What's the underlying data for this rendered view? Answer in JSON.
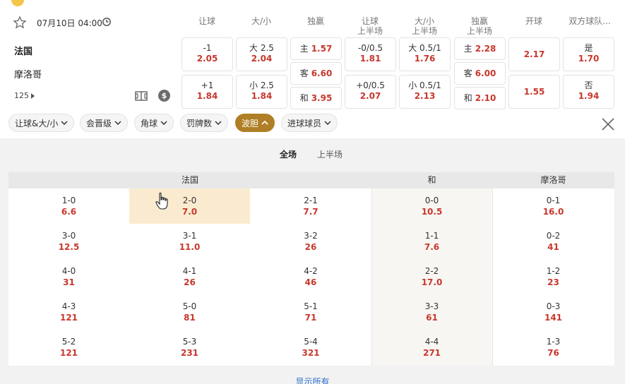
{
  "match": {
    "datetime": "07月10日 04:00",
    "home": "法国",
    "away": "摩洛哥",
    "more_count": "125"
  },
  "columns": [
    {
      "l1": "让球",
      "l2": ""
    },
    {
      "l1": "大/小",
      "l2": ""
    },
    {
      "l1": "独赢",
      "l2": ""
    },
    {
      "l1": "让球",
      "l2": "上半场"
    },
    {
      "l1": "大/小",
      "l2": "上半场"
    },
    {
      "l1": "独赢",
      "l2": "上半场"
    },
    {
      "l1": "开球",
      "l2": ""
    },
    {
      "l1": "双方球队...",
      "l2": ""
    }
  ],
  "odds": {
    "handicap": [
      {
        "label": "-1",
        "odd": "2.05"
      },
      {
        "label": "+1",
        "odd": "1.84"
      }
    ],
    "overunder": [
      {
        "label": "大 2.5",
        "odd": "2.04"
      },
      {
        "label": "小 2.5",
        "odd": "1.84"
      }
    ],
    "moneyline": [
      {
        "label": "主",
        "odd": "1.57"
      },
      {
        "label": "客",
        "odd": "6.60"
      },
      {
        "label": "和",
        "odd": "3.95"
      }
    ],
    "handicap_1h": [
      {
        "label": "-0/0.5",
        "odd": "1.81"
      },
      {
        "label": "+0/0.5",
        "odd": "2.07"
      }
    ],
    "overunder_1h": [
      {
        "label": "大 0.5/1",
        "odd": "1.76"
      },
      {
        "label": "小 0.5/1",
        "odd": "2.13"
      }
    ],
    "moneyline_1h": [
      {
        "label": "主",
        "odd": "2.28"
      },
      {
        "label": "客",
        "odd": "6.00"
      },
      {
        "label": "和",
        "odd": "2.10"
      }
    ],
    "kickoff": [
      {
        "odd": "2.17"
      },
      {
        "odd": "1.55"
      }
    ],
    "btts": [
      {
        "label": "是",
        "odd": "1.70"
      },
      {
        "label": "否",
        "odd": "1.94"
      }
    ]
  },
  "chips": [
    {
      "label": "让球&大/小"
    },
    {
      "label": "会晋级"
    },
    {
      "label": "角球"
    },
    {
      "label": "罚牌数"
    },
    {
      "label": "波胆"
    },
    {
      "label": "进球球员"
    }
  ],
  "subtabs": [
    "全场",
    "上半场"
  ],
  "score_table": {
    "headers": {
      "home": "法国",
      "draw": "和",
      "away": "摩洛哥"
    },
    "rows": [
      [
        {
          "s": "1-0",
          "o": "6.6"
        },
        {
          "s": "2-0",
          "o": "7.0"
        },
        {
          "s": "2-1",
          "o": "7.7"
        },
        {
          "s": "0-0",
          "o": "10.5"
        },
        {
          "s": "0-1",
          "o": "16.0"
        }
      ],
      [
        {
          "s": "3-0",
          "o": "12.5"
        },
        {
          "s": "3-1",
          "o": "11.0"
        },
        {
          "s": "3-2",
          "o": "26"
        },
        {
          "s": "1-1",
          "o": "7.6"
        },
        {
          "s": "0-2",
          "o": "41"
        }
      ],
      [
        {
          "s": "4-0",
          "o": "31"
        },
        {
          "s": "4-1",
          "o": "26"
        },
        {
          "s": "4-2",
          "o": "46"
        },
        {
          "s": "2-2",
          "o": "17.0"
        },
        {
          "s": "1-2",
          "o": "23"
        }
      ],
      [
        {
          "s": "4-3",
          "o": "121"
        },
        {
          "s": "5-0",
          "o": "81"
        },
        {
          "s": "5-1",
          "o": "71"
        },
        {
          "s": "3-3",
          "o": "61"
        },
        {
          "s": "0-3",
          "o": "141"
        }
      ],
      [
        {
          "s": "5-2",
          "o": "121"
        },
        {
          "s": "5-3",
          "o": "231"
        },
        {
          "s": "5-4",
          "o": "321"
        },
        {
          "s": "4-4",
          "o": "271"
        },
        {
          "s": "1-3",
          "o": "76"
        }
      ]
    ]
  },
  "show_all": "显示所有",
  "colors": {
    "accent": "#b07f25",
    "odd": "#c8372d",
    "highlight": "#faebd0",
    "link": "#2a6fc9"
  }
}
